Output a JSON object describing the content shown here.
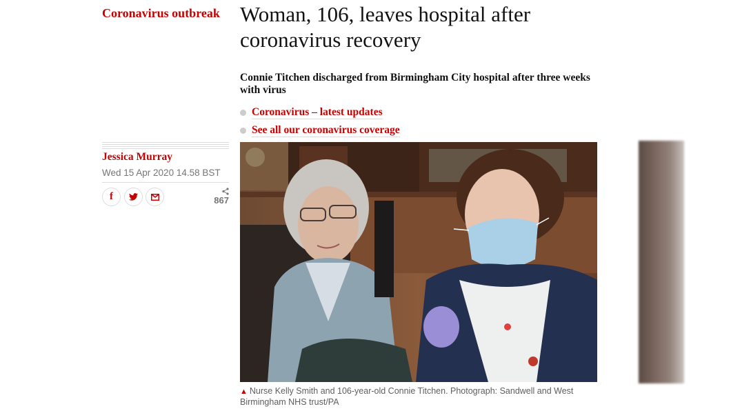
{
  "section": "Coronavirus outbreak",
  "headline": "Woman, 106, leaves hospital after coronavirus recovery",
  "standfirst": "Connie Titchen discharged from Birmingham City hospital after three weeks with virus",
  "related_links": [
    {
      "label": "Coronavirus – latest updates"
    },
    {
      "label": "See all our coronavirus coverage"
    }
  ],
  "byline": {
    "author": "Jessica Murray",
    "date": "Wed 15 Apr 2020 14.58 BST"
  },
  "share": {
    "buttons": [
      {
        "name": "facebook",
        "glyph": "f"
      },
      {
        "name": "twitter",
        "glyph": "t"
      },
      {
        "name": "email",
        "glyph": "✉"
      }
    ],
    "count": "867"
  },
  "caption": "Nurse Kelly Smith and 106-year-old Connie Titchen. Photograph: Sandwell and West Birmingham NHS trust/PA",
  "colors": {
    "accent": "#c70000",
    "text": "#121212",
    "muted": "#767676"
  }
}
